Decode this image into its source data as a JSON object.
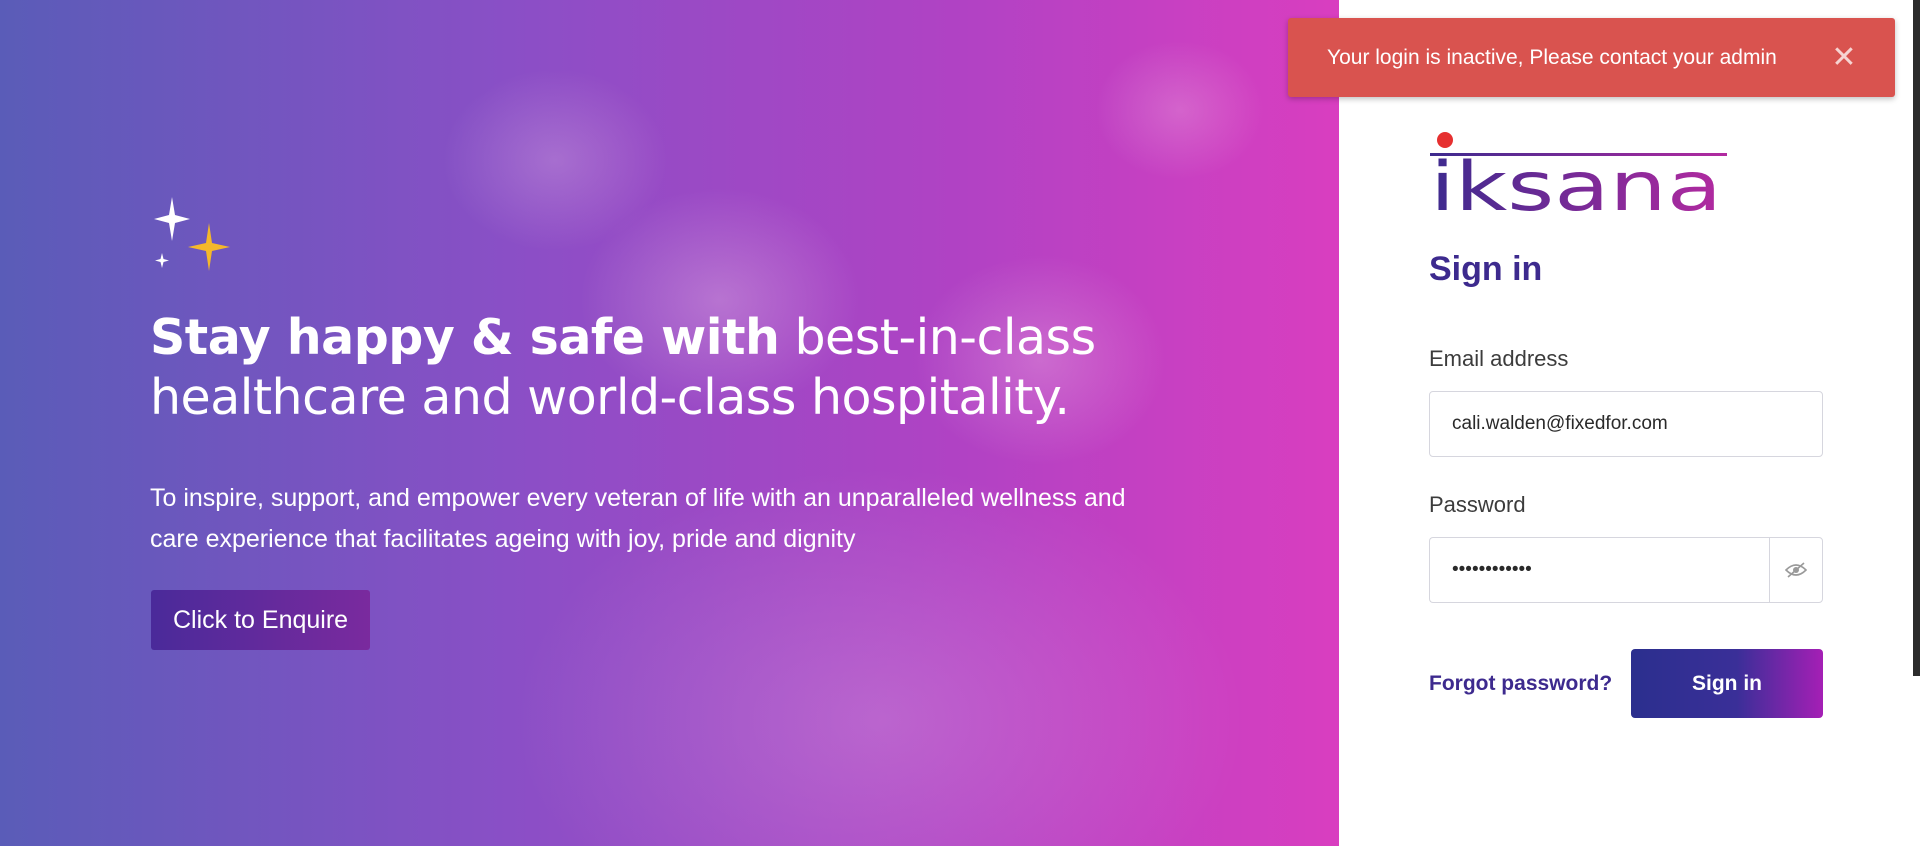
{
  "hero": {
    "heading_bold": "Stay happy & safe with",
    "heading_rest": " best-in-class healthcare and world-class hospitality.",
    "description": "To inspire, support, and empower every veteran of life with an unparalleled wellness and care experience that facilitates ageing with joy, pride and dignity",
    "enquire_label": "Click to Enquire",
    "decoration_icon": "sparkles-icon"
  },
  "panel": {
    "logo_text": "iksana",
    "title": "Sign in",
    "email_label": "Email address",
    "email_value": "cali.walden@fixedfor.com",
    "password_label": "Password",
    "password_value": "••••••••••••",
    "password_toggle_icon": "eye-slash-icon",
    "forgot_label": "Forgot password?",
    "signin_label": "Sign in"
  },
  "toast": {
    "message": "Your login is inactive, Please contact your admin",
    "close_glyph": "✕",
    "close_icon": "close-icon"
  },
  "colors": {
    "brand_purple": "#3d2a8e",
    "toast_red": "#d9534f",
    "hero_start": "#5a5cb8",
    "hero_end": "#d93ec0",
    "sparkle_gold": "#f5b82a",
    "logo_dot_red": "#e63030"
  }
}
